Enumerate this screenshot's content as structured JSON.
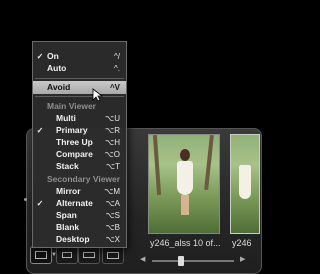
{
  "menu": {
    "display_items": [
      {
        "label": "On",
        "shortcut": "^/",
        "checked": true
      },
      {
        "label": "Auto",
        "shortcut": "^.",
        "checked": false
      }
    ],
    "avoid": {
      "label": "Avoid",
      "shortcut": "^V",
      "highlighted": true
    },
    "main_viewer": {
      "header": "Main Viewer",
      "items": [
        {
          "label": "Multi",
          "shortcut": "⌥U",
          "checked": false
        },
        {
          "label": "Primary",
          "shortcut": "⌥R",
          "checked": true
        },
        {
          "label": "Three Up",
          "shortcut": "⌥H",
          "checked": false
        },
        {
          "label": "Compare",
          "shortcut": "⌥O",
          "checked": false
        },
        {
          "label": "Stack",
          "shortcut": "⌥T",
          "checked": false
        }
      ]
    },
    "secondary_viewer": {
      "header": "Secondary Viewer",
      "items": [
        {
          "label": "Mirror",
          "shortcut": "⌥M",
          "checked": false
        },
        {
          "label": "Alternate",
          "shortcut": "⌥A",
          "checked": true
        },
        {
          "label": "Span",
          "shortcut": "⌥S",
          "checked": false
        },
        {
          "label": "Blank",
          "shortcut": "⌥B",
          "checked": false
        },
        {
          "label": "Desktop",
          "shortcut": "⌥X",
          "checked": false
        }
      ]
    },
    "check_glyph": "✓"
  },
  "filmstrip": {
    "thumbnails": [
      {
        "caption": "y246_alss 10 of..."
      },
      {
        "caption": "y246"
      }
    ],
    "scroll_left_arrow": "◀",
    "scroll_right_arrow": "▶"
  },
  "toolbar": {
    "chevron": "▼"
  }
}
